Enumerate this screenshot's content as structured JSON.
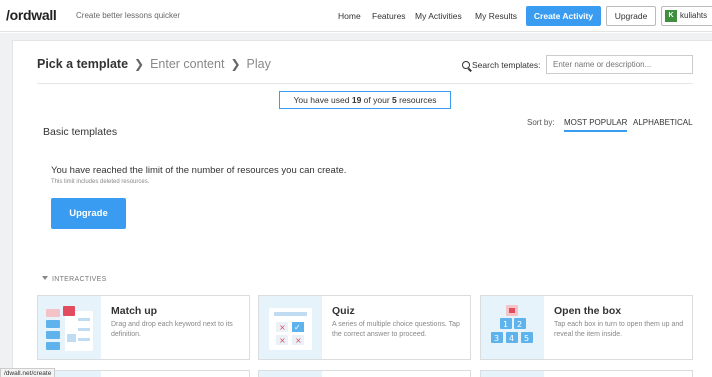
{
  "topbar": {
    "logo": "/ordwall",
    "tagline": "Create better lessons quicker",
    "nav": [
      "Home",
      "Features",
      "My Activities",
      "My Results"
    ],
    "create_label": "Create Activity",
    "upgrade_label": "Upgrade",
    "avatar_letter": "K",
    "username": "kuliahts"
  },
  "steps": {
    "active": "Pick a template",
    "second": "Enter content",
    "third": "Play",
    "separator": "❯"
  },
  "search": {
    "label": "Search templates:",
    "placeholder": "Enter name or description..."
  },
  "usage": {
    "prefix": "You have used ",
    "used": "19",
    "middle": " of your ",
    "limit": "5",
    "suffix": " resources"
  },
  "sort": {
    "label": "Sort by:",
    "options": [
      "MOST POPULAR",
      "ALPHABETICAL"
    ],
    "selected": "MOST POPULAR"
  },
  "basic_title": "Basic templates",
  "limit": {
    "message": "You have reached the limit of the number of resources you can create.",
    "note": "This limit includes deleted resources.",
    "button_label": "Upgrade"
  },
  "section_label": "INTERACTIVES",
  "templates": [
    {
      "title": "Match up",
      "description": "Drag and drop each keyword next to its definition.",
      "icon": "match-up-icon"
    },
    {
      "title": "Quiz",
      "description": "A series of multiple choice questions. Tap the correct answer to proceed.",
      "icon": "quiz-icon"
    },
    {
      "title": "Open the box",
      "description": "Tap each box in turn to open them up and reveal the item inside.",
      "icon": "open-box-icon"
    }
  ],
  "status_url": "/dwall.net/create",
  "colors": {
    "accent": "#3a9cf0",
    "thumb_bg": "#e6f3fb",
    "avatar": "#3f8f3f"
  }
}
